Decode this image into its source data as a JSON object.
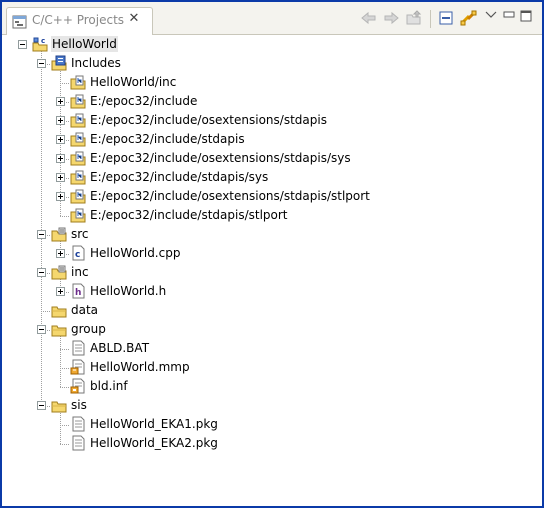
{
  "view": {
    "title": "C/C++ Projects",
    "tab_icon": "cpp-projects-view-icon",
    "toolbar_icons": [
      "back-arrow-icon",
      "forward-arrow-icon",
      "up-folder-icon",
      "collapse-all-icon",
      "link-with-editor-icon",
      "view-menu-chevron-icon",
      "minimize-icon",
      "maximize-icon"
    ]
  },
  "tree": [
    {
      "label": "HelloWorld",
      "depth": 0,
      "icon": "c-project-icon",
      "expander": "minus"
    },
    {
      "label": "Includes",
      "depth": 1,
      "icon": "includes-container-icon",
      "expander": "minus"
    },
    {
      "label": "HelloWorld/inc",
      "depth": 2,
      "icon": "include-folder-icon",
      "expander": "none"
    },
    {
      "label": "E:/epoc32/include",
      "depth": 2,
      "icon": "include-folder-icon",
      "expander": "plus"
    },
    {
      "label": "E:/epoc32/include/osextensions/stdapis",
      "depth": 2,
      "icon": "include-folder-icon",
      "expander": "plus"
    },
    {
      "label": "E:/epoc32/include/stdapis",
      "depth": 2,
      "icon": "include-folder-icon",
      "expander": "plus"
    },
    {
      "label": "E:/epoc32/include/osextensions/stdapis/sys",
      "depth": 2,
      "icon": "include-folder-icon",
      "expander": "plus"
    },
    {
      "label": "E:/epoc32/include/stdapis/sys",
      "depth": 2,
      "icon": "include-folder-icon",
      "expander": "plus"
    },
    {
      "label": "E:/epoc32/include/osextensions/stdapis/stlport",
      "depth": 2,
      "icon": "include-folder-icon",
      "expander": "plus"
    },
    {
      "label": "E:/epoc32/include/stdapis/stlport",
      "depth": 2,
      "icon": "include-folder-icon",
      "expander": "none"
    },
    {
      "label": "src",
      "depth": 1,
      "icon": "source-folder-icon",
      "expander": "minus"
    },
    {
      "label": "HelloWorld.cpp",
      "depth": 2,
      "icon": "cpp-file-icon",
      "expander": "plus"
    },
    {
      "label": "inc",
      "depth": 1,
      "icon": "source-folder-icon",
      "expander": "minus"
    },
    {
      "label": "HelloWorld.h",
      "depth": 2,
      "icon": "header-file-icon",
      "expander": "plus"
    },
    {
      "label": "data",
      "depth": 1,
      "icon": "folder-icon",
      "expander": "none"
    },
    {
      "label": "group",
      "depth": 1,
      "icon": "folder-icon",
      "expander": "minus"
    },
    {
      "label": "ABLD.BAT",
      "depth": 2,
      "icon": "text-file-icon",
      "expander": "none"
    },
    {
      "label": "HelloWorld.mmp",
      "depth": 2,
      "icon": "mmp-file-icon",
      "expander": "none"
    },
    {
      "label": "bld.inf",
      "depth": 2,
      "icon": "inf-file-icon",
      "expander": "none"
    },
    {
      "label": "sis",
      "depth": 1,
      "icon": "folder-icon",
      "expander": "minus"
    },
    {
      "label": "HelloWorld_EKA1.pkg",
      "depth": 2,
      "icon": "text-file-icon",
      "expander": "none"
    },
    {
      "label": "HelloWorld_EKA2.pkg",
      "depth": 2,
      "icon": "text-file-icon",
      "expander": "none"
    }
  ],
  "selected_index": 0
}
